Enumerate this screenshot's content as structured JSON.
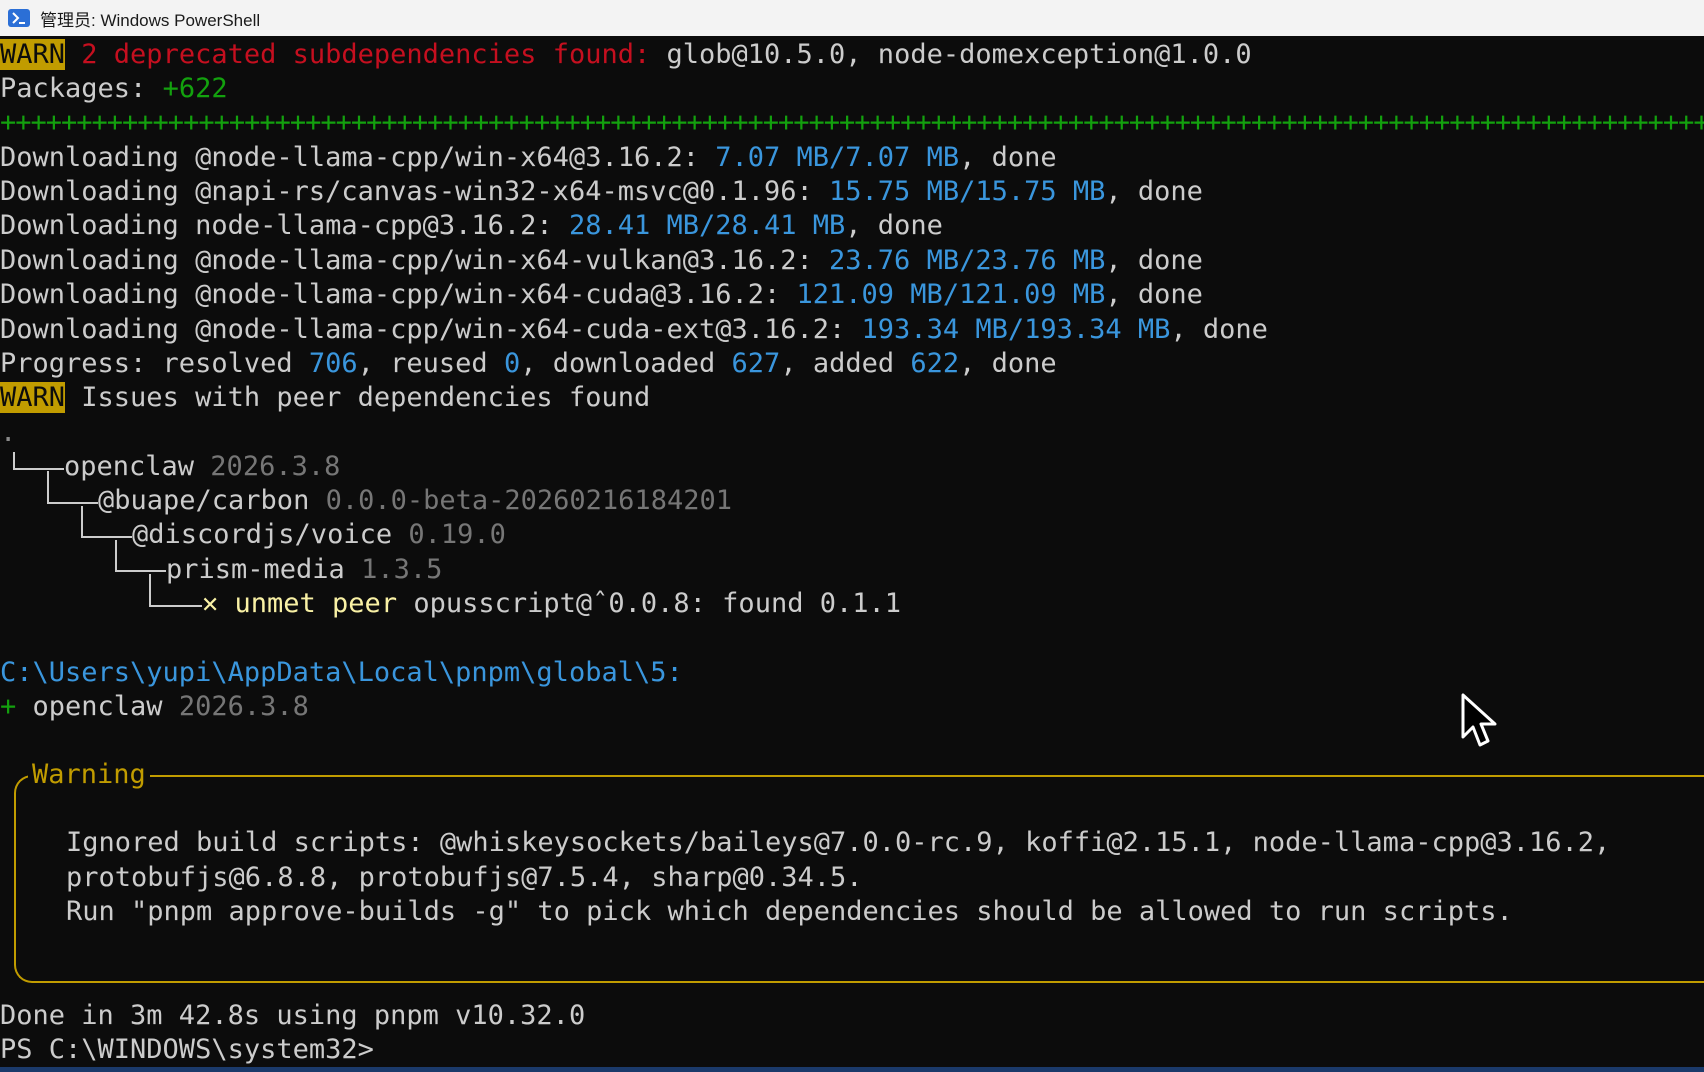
{
  "window": {
    "title": "管理员: Windows PowerShell"
  },
  "terminal": {
    "warn1": {
      "tag": "WARN",
      "message": " 2 deprecated subdependencies found:",
      "rest": " glob@10.5.0, node-domexception@1.0.0"
    },
    "packages": {
      "label": "Packages: ",
      "value": "+622"
    },
    "plus_bar": "++++++++++++++++++++++++++++++++++++++++++++++++++++++++++++++++++++++++++++++++++++++++++++++++++++++++++++++++++++++++++",
    "downloads": [
      {
        "prefix": "Downloading @node-llama-cpp/win-x64@3.16.2: ",
        "size": "7.07 MB/7.07 MB",
        "suffix": ", done"
      },
      {
        "prefix": "Downloading @napi-rs/canvas-win32-x64-msvc@0.1.96: ",
        "size": "15.75 MB/15.75 MB",
        "suffix": ", done"
      },
      {
        "prefix": "Downloading node-llama-cpp@3.16.2: ",
        "size": "28.41 MB/28.41 MB",
        "suffix": ", done"
      },
      {
        "prefix": "Downloading @node-llama-cpp/win-x64-vulkan@3.16.2: ",
        "size": "23.76 MB/23.76 MB",
        "suffix": ", done"
      },
      {
        "prefix": "Downloading @node-llama-cpp/win-x64-cuda@3.16.2: ",
        "size": "121.09 MB/121.09 MB",
        "suffix": ", done"
      },
      {
        "prefix": "Downloading @node-llama-cpp/win-x64-cuda-ext@3.16.2: ",
        "size": "193.34 MB/193.34 MB",
        "suffix": ", done"
      }
    ],
    "progress": {
      "label": "Progress: resolved ",
      "resolved": "706",
      "t1": ", reused ",
      "reused": "0",
      "t2": ", downloaded ",
      "downloaded": "627",
      "t3": ", added ",
      "added": "622",
      "t4": ", done"
    },
    "warn2": {
      "tag": "WARN",
      "message": " Issues with peer dependencies found"
    },
    "tree": {
      "root": ".",
      "n1": {
        "name": "openclaw",
        "version": " 2026.3.8"
      },
      "n2": {
        "name": "@buape/carbon",
        "version": " 0.0.0-beta-20260216184201"
      },
      "n3": {
        "name": "@discordjs/voice",
        "version": " 0.19.0"
      },
      "n4": {
        "name": "prism-media",
        "version": " 1.3.5"
      },
      "n5": {
        "mark": "✕ ",
        "text": "unmet peer ",
        "rest": "opusscript@ˆ0.0.8: found 0.1.1"
      }
    },
    "global_path": "C:\\Users\\yupi\\AppData\\Local\\pnpm\\global\\5:",
    "added_pkg": {
      "plus": "+ ",
      "name": "openclaw",
      "version": " 2026.3.8"
    },
    "warning_box": {
      "title": "Warning",
      "line1": "Ignored build scripts: @whiskeysockets/baileys@7.0.0-rc.9, koffi@2.15.1, node-llama-cpp@3.16.2,",
      "line2": "protobufjs@6.8.8, protobufjs@7.5.4, sharp@0.34.5.",
      "line3": "Run \"pnpm approve-builds -g\" to pick which dependencies should be allowed to run scripts."
    },
    "done": "Done in 3m 42.8s using pnpm v10.32.0",
    "prompt": "PS C:\\WINDOWS\\system32>"
  }
}
